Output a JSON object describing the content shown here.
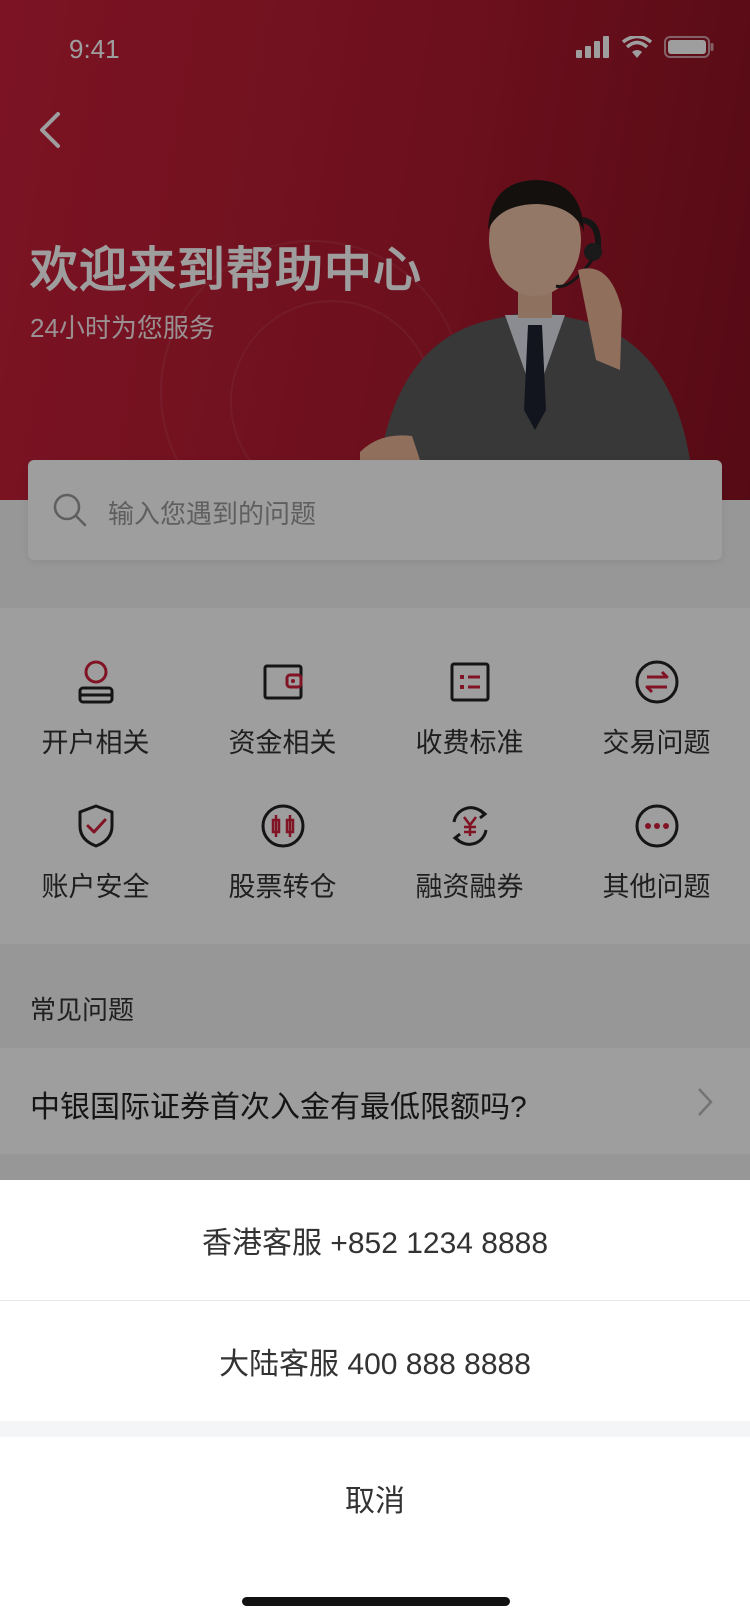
{
  "status_bar": {
    "time": "9:41"
  },
  "hero": {
    "title": "欢迎来到帮助中心",
    "subtitle": "24小时为您服务"
  },
  "search": {
    "placeholder": "输入您遇到的问题"
  },
  "categories": [
    {
      "label": "开户相关",
      "icon": "user-icon"
    },
    {
      "label": "资金相关",
      "icon": "wallet-icon"
    },
    {
      "label": "收费标准",
      "icon": "list-icon"
    },
    {
      "label": "交易问题",
      "icon": "swap-icon"
    },
    {
      "label": "账户安全",
      "icon": "shield-check-icon"
    },
    {
      "label": "股票转仓",
      "icon": "candlestick-icon"
    },
    {
      "label": "融资融券",
      "icon": "yuan-cycle-icon"
    },
    {
      "label": "其他问题",
      "icon": "more-icon"
    }
  ],
  "faq": {
    "title": "常见问题",
    "items": [
      "中银国际证券首次入金有最低限额吗?"
    ]
  },
  "action_sheet": {
    "options": [
      "香港客服 +852 1234 8888",
      "大陆客服 400 888 8888"
    ],
    "cancel": "取消"
  },
  "colors": {
    "brand_red": "#c8203a",
    "accent_red": "#d0213b"
  }
}
